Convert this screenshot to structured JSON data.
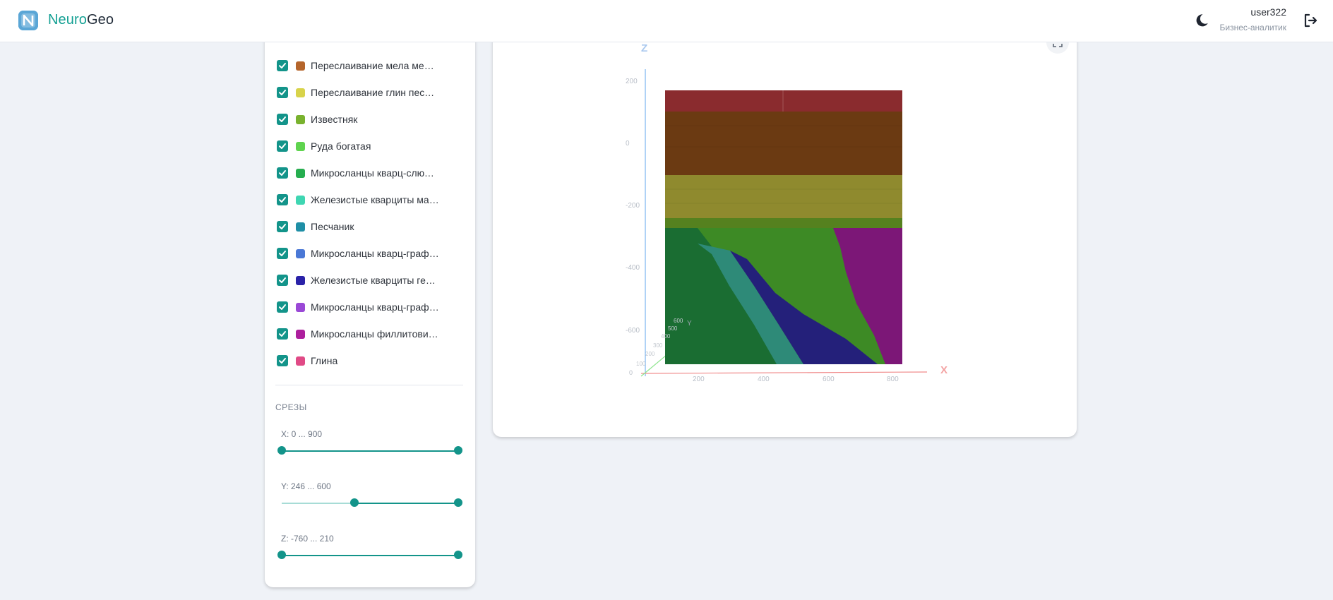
{
  "app": {
    "name_part1": "Neuro",
    "name_part2": "Geo"
  },
  "user": {
    "name": "user322",
    "role": "Бизнес-аналитик"
  },
  "layers": [
    {
      "label": "Переслаивание мела мергелей",
      "color": "#b5652b",
      "checked": true
    },
    {
      "label": "Переслаивание глин песчаников",
      "color": "#d8d34a",
      "checked": true
    },
    {
      "label": "Известняк",
      "color": "#79b22e",
      "checked": true
    },
    {
      "label": "Руда богатая",
      "color": "#5fd44f",
      "checked": true
    },
    {
      "label": "Микросланцы кварц-слюдистые",
      "color": "#26ae4f",
      "checked": true
    },
    {
      "label": "Железистые кварциты магнетитовые",
      "color": "#3fd6b2",
      "checked": true
    },
    {
      "label": "Песчаник",
      "color": "#1f8fa6",
      "checked": true
    },
    {
      "label": "Микросланцы кварц-графитовые",
      "color": "#4a78d6",
      "checked": true
    },
    {
      "label": "Железистые кварциты гематитовые",
      "color": "#2a22a8",
      "checked": true
    },
    {
      "label": "Микросланцы кварц-графит-слюдистые",
      "color": "#9a48d6",
      "checked": true
    },
    {
      "label": "Микросланцы филлитовидные",
      "color": "#ad1f9d",
      "checked": true
    },
    {
      "label": "Глина",
      "color": "#e04a86",
      "checked": true
    }
  ],
  "slices": {
    "title": "СРЕЗЫ",
    "x": {
      "label": "X: 0 ... 900",
      "range": [
        0,
        900
      ],
      "value": [
        0,
        900
      ]
    },
    "y": {
      "label": "Y: 246 ... 600",
      "range": [
        0,
        600
      ],
      "value": [
        246,
        600
      ]
    },
    "z": {
      "label": "Z: -760 ... 210",
      "range": [
        -760,
        210
      ],
      "value": [
        -760,
        210
      ]
    }
  },
  "scene": {
    "axes": {
      "x": "X",
      "y": "Y",
      "z": "Z"
    },
    "z_ticks": [
      "200",
      "0",
      "-200",
      "-400",
      "-600"
    ],
    "x_ticks": [
      "200",
      "400",
      "600",
      "800"
    ],
    "y_ticks": [
      "100",
      "200",
      "300",
      "400",
      "500",
      "600"
    ],
    "origin": "0"
  },
  "colors": {
    "accent": "#13948a",
    "axis_x": "#f08a8a",
    "axis_y": "#8ee58e",
    "axis_z": "#7ab3f0"
  }
}
